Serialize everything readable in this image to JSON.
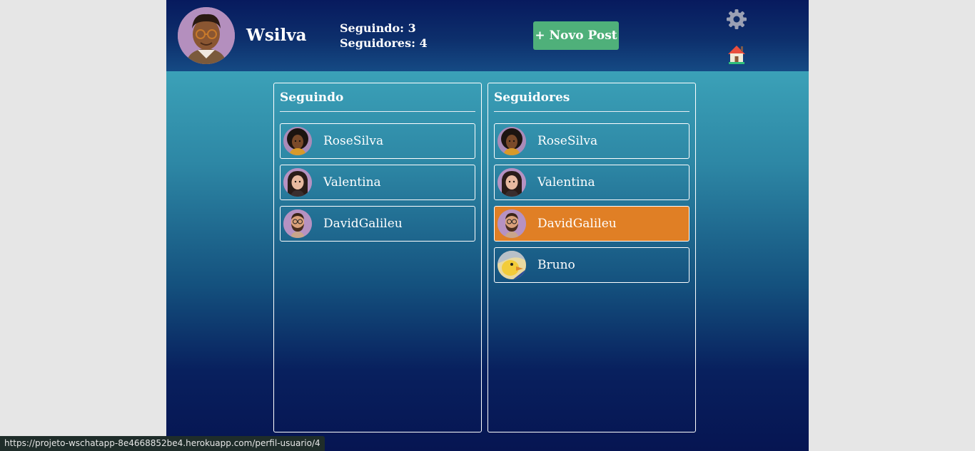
{
  "header": {
    "username": "Wsilva",
    "following_label": "Seguindo: 3",
    "followers_label": "Seguidores: 4",
    "new_post_label": "+ Novo Post",
    "settings_icon": "gear-icon",
    "home_icon": "home-icon"
  },
  "following_panel": {
    "title": "Seguindo",
    "users": [
      {
        "name": "RoseSilva",
        "avatar": "woman-curly-avatar"
      },
      {
        "name": "Valentina",
        "avatar": "woman-avatar"
      },
      {
        "name": "DavidGalileu",
        "avatar": "bearded-man-avatar"
      }
    ]
  },
  "followers_panel": {
    "title": "Seguidores",
    "users": [
      {
        "name": "RoseSilva",
        "avatar": "woman-curly-avatar"
      },
      {
        "name": "Valentina",
        "avatar": "woman-avatar"
      },
      {
        "name": "DavidGalileu",
        "avatar": "bearded-man-avatar",
        "highlighted": true
      },
      {
        "name": "Bruno",
        "avatar": "duck-avatar"
      }
    ]
  },
  "status_bar": {
    "url": "https://projeto-wschatapp-8e4668852be4.herokuapp.com/perfil-usuario/4"
  },
  "colors": {
    "highlight": "#e07f25",
    "new_post_button": "#4fb07a",
    "header_bg": "#0d2f6c"
  }
}
